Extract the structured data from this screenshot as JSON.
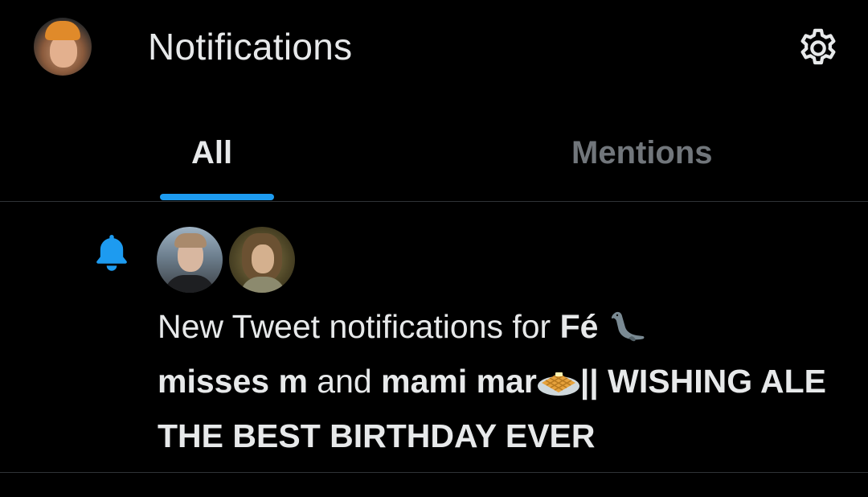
{
  "header": {
    "title": "Notifications",
    "avatar_icon": "profile-avatar",
    "settings_icon": "gear-icon"
  },
  "tabs": [
    {
      "label": "All",
      "active": true
    },
    {
      "label": "Mentions",
      "active": false
    }
  ],
  "notification": {
    "icon": "bell-icon",
    "prefix": "New Tweet notifications for ",
    "user1": "Fé ",
    "user1_emoji": "seal-emoji",
    "user2": "misses m",
    "joiner": " and ",
    "user3": "mami mar",
    "user3_emoji": "waffle-emoji",
    "user3_suffix": "|| WISHING ALE THE BEST BIRTHDAY EVER"
  },
  "colors": {
    "background": "#000000",
    "text_primary": "#e7e9ea",
    "text_secondary": "#71767b",
    "accent": "#1d9bf0",
    "divider": "#2f3336"
  }
}
